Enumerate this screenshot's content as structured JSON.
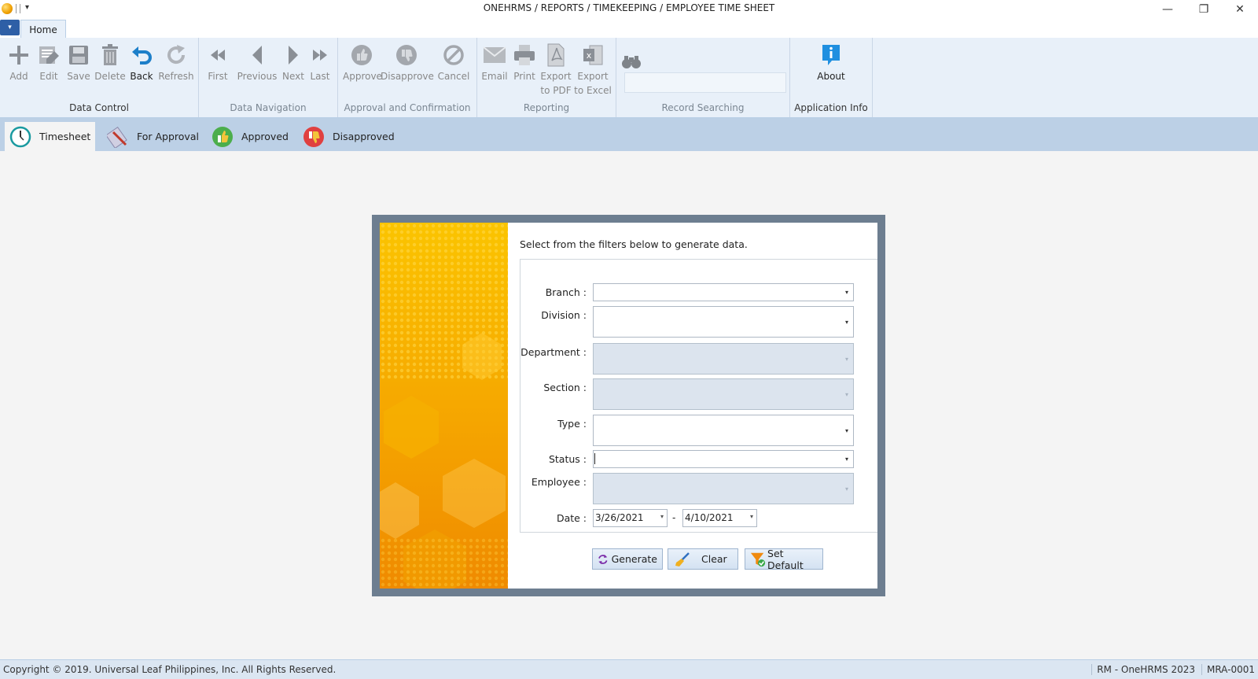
{
  "window": {
    "title": "ONEHRMS / REPORTS / TIMEKEEPING / EMPLOYEE TIME SHEET",
    "menu_glyph": "▾",
    "minimize": "—",
    "restore": "❐",
    "close": "✕"
  },
  "ribbon_tabs": {
    "file_glyph": "▾",
    "home": "Home"
  },
  "ribbon": {
    "data_control": {
      "label": "Data Control",
      "buttons": [
        {
          "label": "Add",
          "icon": "plus-icon"
        },
        {
          "label": "Edit",
          "icon": "edit-icon"
        },
        {
          "label": "Save",
          "icon": "floppy-icon"
        },
        {
          "label": "Delete",
          "icon": "trash-icon"
        },
        {
          "label": "Back",
          "icon": "undo-icon"
        },
        {
          "label": "Refresh",
          "icon": "refresh-icon"
        }
      ]
    },
    "data_navigation": {
      "label": "Data Navigation",
      "buttons": [
        {
          "label": "First",
          "icon": "first-icon"
        },
        {
          "label": "Previous",
          "icon": "previous-icon"
        },
        {
          "label": "Next",
          "icon": "next-icon"
        },
        {
          "label": "Last",
          "icon": "last-icon"
        }
      ]
    },
    "approval": {
      "label": "Approval and Confirmation",
      "buttons": [
        {
          "label": "Approve",
          "icon": "thumbs-up-icon"
        },
        {
          "label": "Disapprove",
          "icon": "thumbs-down-icon"
        },
        {
          "label": "Cancel",
          "icon": "cancel-icon"
        }
      ]
    },
    "reporting": {
      "label": "Reporting",
      "buttons": [
        {
          "label": "Email",
          "icon": "email-icon"
        },
        {
          "label": "Print",
          "icon": "printer-icon"
        },
        {
          "label": "Export",
          "label2": "to PDF",
          "icon": "pdf-icon"
        },
        {
          "label": "Export",
          "label2": "to Excel",
          "icon": "excel-icon"
        }
      ]
    },
    "record_searching": {
      "label": "Record Searching",
      "icon": "binoculars-icon",
      "search_value": ""
    },
    "application_info": {
      "label": "Application Info",
      "buttons": [
        {
          "label": "About",
          "icon": "info-icon"
        }
      ]
    }
  },
  "subtabs": [
    {
      "label": "Timesheet",
      "icon": "clock-icon",
      "active": true
    },
    {
      "label": "For Approval",
      "icon": "pencil-icon",
      "active": false
    },
    {
      "label": "Approved",
      "icon": "thumbs-up-icon",
      "active": false
    },
    {
      "label": "Disapproved",
      "icon": "thumbs-down-icon",
      "active": false
    }
  ],
  "filter_dialog": {
    "instruction": "Select from the filters below to generate data.",
    "fields": {
      "branch": {
        "label": "Branch :",
        "value": "",
        "enabled": true
      },
      "division": {
        "label": "Division :",
        "value": "",
        "enabled": true
      },
      "department": {
        "label": "Department :",
        "value": "",
        "enabled": false
      },
      "section": {
        "label": "Section :",
        "value": "",
        "enabled": false
      },
      "type": {
        "label": "Type :",
        "value": "",
        "enabled": true
      },
      "status": {
        "label": "Status :",
        "value": "",
        "enabled": true,
        "focused": true
      },
      "employee": {
        "label": "Employee :",
        "value": "",
        "enabled": false
      }
    },
    "date": {
      "label": "Date :",
      "from": "3/26/2021",
      "separator": "-",
      "to": "4/10/2021"
    },
    "buttons": {
      "generate": "Generate",
      "clear": "Clear",
      "set_default": "Set Default"
    },
    "dropdown_glyph": "▾"
  },
  "footer": {
    "copyright": "Copyright © 2019.  Universal Leaf Philippines, Inc. All Rights Reserved.",
    "app_version": "RM - OneHRMS 2023",
    "code": "MRA-0001"
  },
  "colors": {
    "ribbon_bg": "#e8f0f9",
    "subtab_bar": "#bcd0e6",
    "dialog_frame": "#6d7e90",
    "disabled_field": "#dce4ee",
    "about_icon": "#1f8fe0",
    "back_icon": "#1d7fc9",
    "banner_orange": "#f5a500"
  }
}
